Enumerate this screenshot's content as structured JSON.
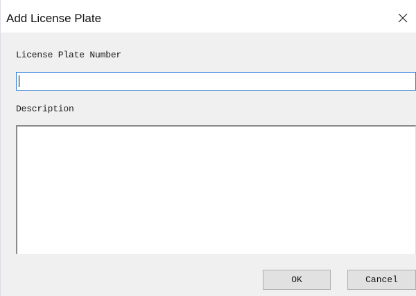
{
  "dialog": {
    "title": "Add License Plate",
    "close_icon": "close-icon"
  },
  "form": {
    "plate_label": "License Plate Number",
    "plate_value": "",
    "description_label": "Description",
    "description_value": ""
  },
  "buttons": {
    "ok_label": "OK",
    "cancel_label": "Cancel"
  },
  "colors": {
    "input_focus_border": "#2f7dd6",
    "dialog_background": "#f0f0f0",
    "button_background": "#e1e1e1"
  }
}
